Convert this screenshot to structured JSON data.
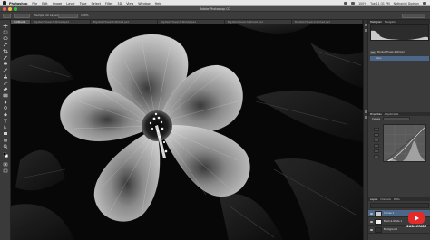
{
  "menubar": {
    "app_name": "Photoshop",
    "menus": [
      "File",
      "Edit",
      "Image",
      "Layer",
      "Type",
      "Select",
      "Filter",
      "3D",
      "View",
      "Window",
      "Help"
    ],
    "status_clock": "Tue 11:31 PM",
    "status_user": "Nathaniel Dodson",
    "zoom_status": "100%"
  },
  "window": {
    "title": "Adobe Photoshop CC"
  },
  "options_bar": {
    "sample_label": "Sample All Layers",
    "opacity_label": "100%",
    "workspace": "Essentials"
  },
  "tabs": [
    {
      "label": "Untitled-1",
      "active": true
    },
    {
      "label": "Big-Red-Flower-S-Wicked.psd",
      "active": false
    },
    {
      "label": "Big-Red-Flower-S-Wicked.psd",
      "active": false
    },
    {
      "label": "Big-Red-Flower-S-Wicked.psd",
      "active": false
    },
    {
      "label": "Big-Red-Flower-S-Wicked.psd",
      "active": false
    },
    {
      "label": "Big-Red-Flower-S-Wicked.psd",
      "active": false
    }
  ],
  "panels": {
    "histogram_tabs": [
      "Histogram",
      "Navigator"
    ],
    "history_items": [
      "Big-Red-Flower-S-Wicked",
      "Open"
    ],
    "properties_tabs": [
      "Properties",
      "Adjustments"
    ],
    "properties_title": "Curves",
    "layers_tabs": [
      "Layers",
      "Channels",
      "Paths"
    ],
    "layers": [
      {
        "name": "Curves 1",
        "thumb": "#c9c9c9"
      },
      {
        "name": "Black & White 1",
        "thumb": "#f0f0f0"
      },
      {
        "name": "Background",
        "thumb": "#303030"
      }
    ]
  },
  "watermark": {
    "subscribe": "SUBSCRIBE"
  },
  "colors": {
    "accent_selected": "#4c6787",
    "youtube_red": "#e22c2c"
  }
}
